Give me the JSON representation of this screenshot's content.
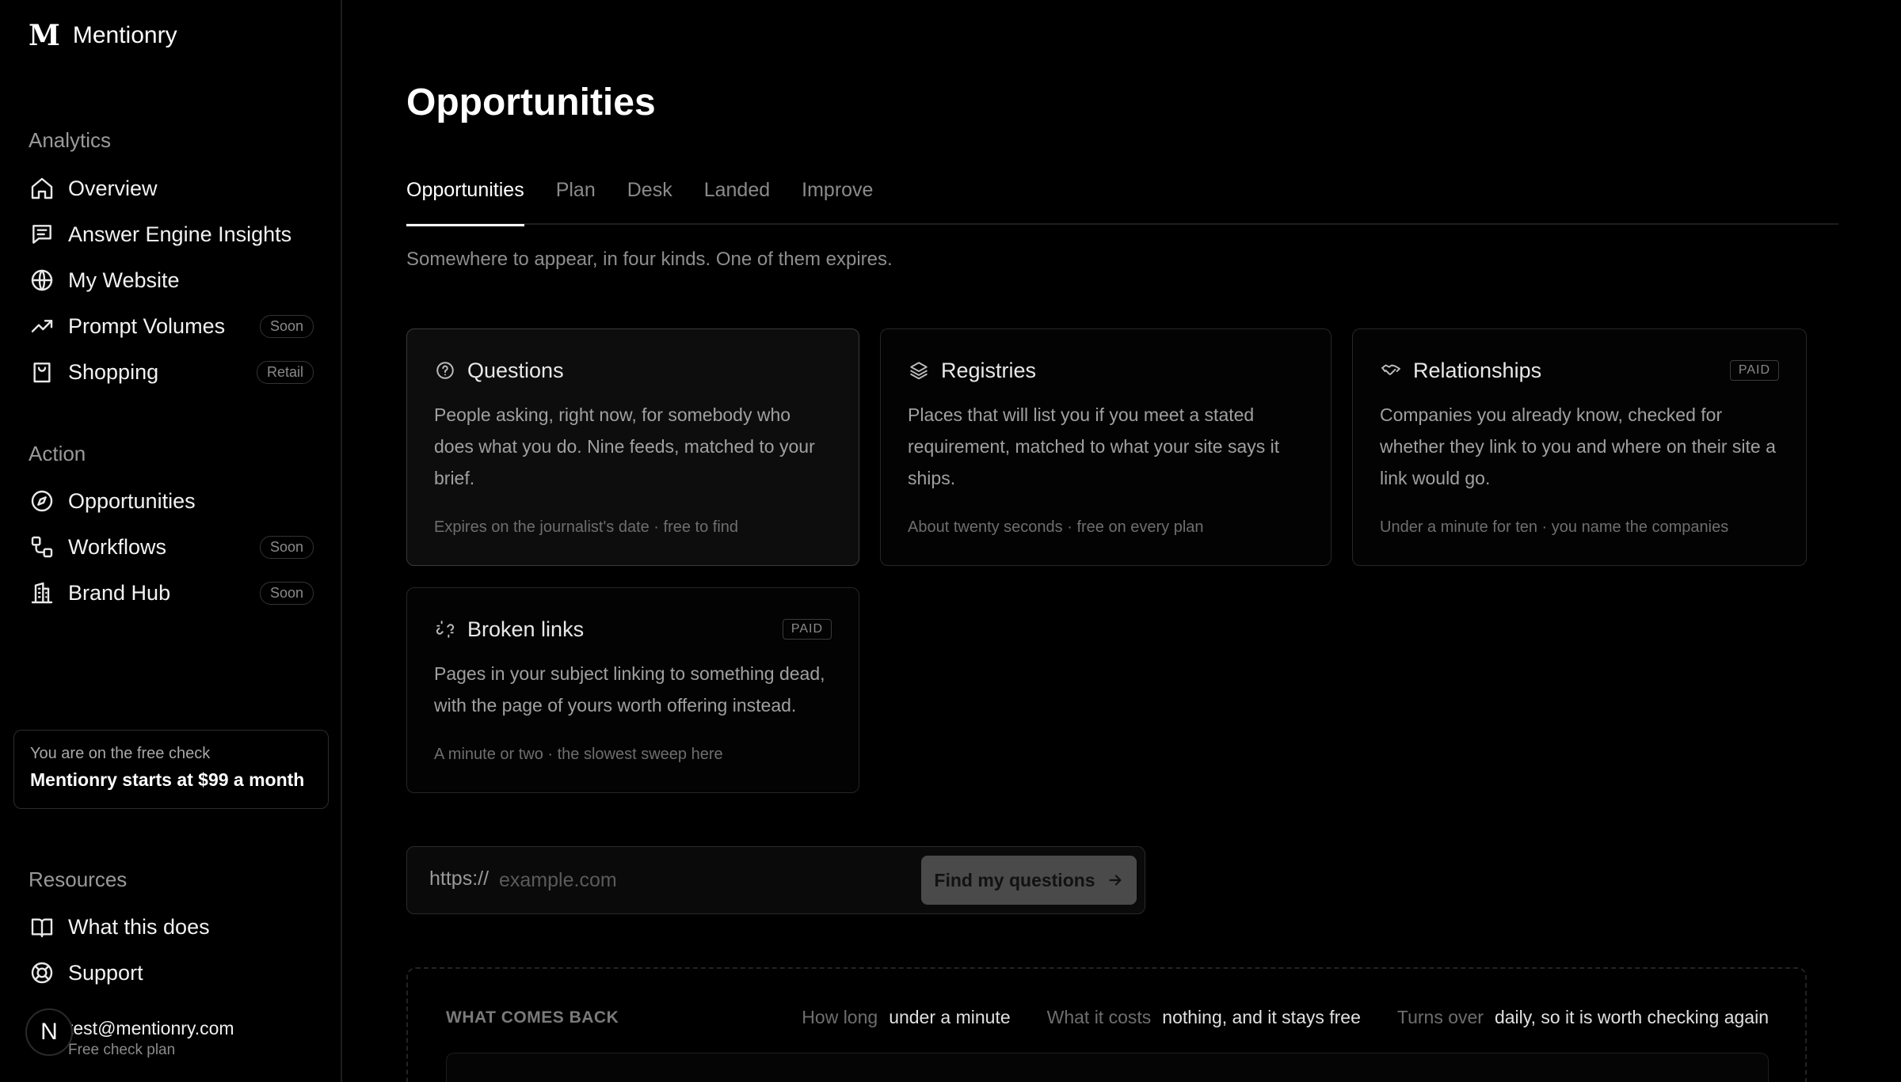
{
  "brand": {
    "logo": "M",
    "name": "Mentionry"
  },
  "sidebar": {
    "analytics_label": "Analytics",
    "analytics_items": [
      {
        "label": "Overview",
        "icon": "home-icon"
      },
      {
        "label": "Answer Engine Insights",
        "icon": "chat-icon"
      },
      {
        "label": "My Website",
        "icon": "globe-icon"
      },
      {
        "label": "Prompt Volumes",
        "icon": "trend-icon",
        "badge": "Soon"
      },
      {
        "label": "Shopping",
        "icon": "bag-icon",
        "badge": "Retail"
      }
    ],
    "action_label": "Action",
    "action_items": [
      {
        "label": "Opportunities",
        "icon": "compass-icon"
      },
      {
        "label": "Workflows",
        "icon": "workflow-icon",
        "badge": "Soon"
      },
      {
        "label": "Brand Hub",
        "icon": "building-icon",
        "badge": "Soon"
      }
    ],
    "plan_card": {
      "line1": "You are on the free check",
      "line2": "Mentionry starts at $99 a month"
    },
    "resources_label": "Resources",
    "resources_items": [
      {
        "label": "What this does",
        "icon": "book-icon"
      },
      {
        "label": "Support",
        "icon": "lifebuoy-icon"
      }
    ],
    "user": {
      "avatar": "N",
      "email": "test@mentionry.com",
      "plan": "Free check plan"
    }
  },
  "main": {
    "title": "Opportunities",
    "tabs": [
      "Opportunities",
      "Plan",
      "Desk",
      "Landed",
      "Improve"
    ],
    "active_tab": "Opportunities",
    "subtitle": "Somewhere to appear, in four kinds. One of them expires.",
    "cards": [
      {
        "title": "Questions",
        "icon": "question-circle-icon",
        "body": "People asking, right now, for somebody who does what you do. Nine feeds, matched to your brief.",
        "foot": "Expires on the journalist's date · free to find"
      },
      {
        "title": "Registries",
        "icon": "layers-icon",
        "body": "Places that will list you if you meet a stated requirement, matched to what your site says it ships.",
        "foot": "About twenty seconds · free on every plan"
      },
      {
        "title": "Relationships",
        "icon": "handshake-icon",
        "badge": "PAID",
        "body": "Companies you already know, checked for whether they link to you and where on their site a link would go.",
        "foot": "Under a minute for ten · you name the companies"
      },
      {
        "title": "Broken links",
        "icon": "broken-link-icon",
        "badge": "PAID",
        "body": "Pages in your subject linking to something dead, with the page of yours worth offering instead.",
        "foot": "A minute or two · the slowest sweep here"
      }
    ],
    "url_form": {
      "prefix": "https://",
      "placeholder": "example.com",
      "button": "Find my questions"
    },
    "info": {
      "label": "WHAT COMES BACK",
      "how_long_k": "How long",
      "how_long_v": "under a minute",
      "cost_k": "What it costs",
      "cost_v": "nothing, and it stays free",
      "turns_k": "Turns over",
      "turns_v": "daily, so it is worth checking again"
    }
  }
}
